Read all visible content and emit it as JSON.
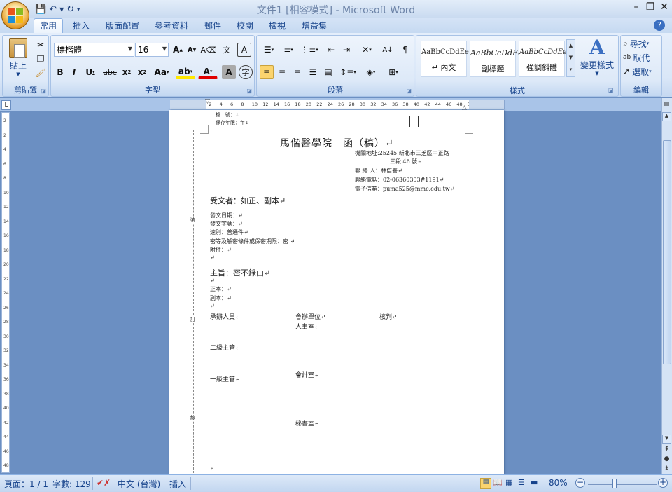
{
  "window": {
    "title": "文件1 [相容模式] - Microsoft Word",
    "controls": [
      "–",
      "❐",
      "✕"
    ]
  },
  "quick_access": {
    "save_icon": "save-icon",
    "undo_icon": "undo-icon",
    "redo_icon": "redo-icon",
    "customize_icon": "chevron-down-icon"
  },
  "tabs": [
    "常用",
    "插入",
    "版面配置",
    "參考資料",
    "郵件",
    "校閱",
    "檢視",
    "增益集"
  ],
  "active_tab": "常用",
  "ribbon": {
    "clipboard": {
      "label": "剪貼簿",
      "paste_label": "貼上"
    },
    "font": {
      "label": "字型",
      "font_name": "標楷體",
      "font_size": "16"
    },
    "paragraph": {
      "label": "段落"
    },
    "styles": {
      "label": "樣式",
      "tiles": [
        {
          "preview": "AaBbCcDdEe",
          "name": "↵ 內文"
        },
        {
          "preview": "AaBbCcDdEe",
          "name": "副標題"
        },
        {
          "preview": "AaBbCcDdEe",
          "name": "強調斜體"
        }
      ],
      "change_styles_label": "變更樣式"
    },
    "editing": {
      "label": "編輯",
      "find": "尋找",
      "replace": "取代",
      "select": "選取"
    }
  },
  "ruler_ticks": [
    "6",
    "4",
    "2",
    "2",
    "4",
    "6",
    "8",
    "10",
    "12",
    "14",
    "16",
    "18",
    "20",
    "22",
    "24",
    "26",
    "28",
    "30",
    "32",
    "34",
    "36",
    "38",
    "40",
    "42",
    "44",
    "46",
    "48",
    "52",
    "54",
    "56",
    "58"
  ],
  "vruler_ticks": [
    "2",
    "2",
    "4",
    "6",
    "8",
    "10",
    "12",
    "14",
    "16",
    "18",
    "20",
    "22",
    "24",
    "26",
    "28",
    "30",
    "32",
    "34",
    "36",
    "38",
    "40",
    "42",
    "44",
    "46",
    "48"
  ],
  "document": {
    "top_fields": {
      "line1": "檔　號：↓",
      "line2": "保存年限：年↓"
    },
    "title": "馬偕醫學院　函（稿）↵",
    "org_info": [
      "機關地址:25245 新北市三芝區中正路",
      "三段 46 號↵",
      "聯 絡 人：林倍善↵",
      "聯絡電話：02-06360303#1191↵",
      "電子信箱：puma525@mmc.edu.tw↵"
    ],
    "recipient": "受文者：如正、副本↵",
    "doc_fields": [
      "發文日期：↵",
      "發文字號：↵",
      "速別：普通件↵",
      "密等及解密條件或保密期限：密 ↵",
      "附件：↵",
      "↵"
    ],
    "subject": "主旨：密不錄由↵",
    "cc_fields": [
      "↵",
      "正本：↵",
      "副本：↵",
      "↵"
    ],
    "sign_headers": [
      "承辦人員↵",
      "會辦單位↵",
      "核判↵"
    ],
    "sign_dept1": "人事室↵",
    "level2": "二級主管↵",
    "level1": "一級主管↵",
    "dept_accounting": "會計室↵",
    "dept_secretary": "秘書室↵",
    "margin_mark_1": "裝",
    "margin_mark_2": "訂",
    "margin_mark_3": "線",
    "end_mark": "↵"
  },
  "status": {
    "page": "頁面：1 / 1",
    "words": "字數: 129",
    "language": "中文 (台灣)",
    "mode": "插入",
    "zoom": "80%"
  }
}
